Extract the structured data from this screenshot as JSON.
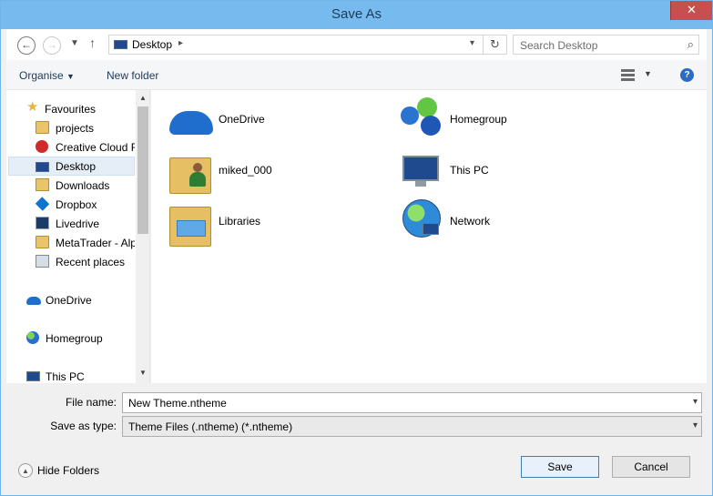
{
  "window": {
    "title": "Save As",
    "close_label": "✕"
  },
  "nav": {
    "back_icon": "arrow-left",
    "forward_icon": "arrow-right",
    "recent_icon": "chevron-down",
    "up_icon": "arrow-up",
    "address": "Desktop",
    "search_placeholder": "Search Desktop"
  },
  "toolbar": {
    "organise": "Organise",
    "new_folder": "New folder",
    "help": "?"
  },
  "sidebar": {
    "items": [
      {
        "label": "Favourites"
      },
      {
        "label": "projects"
      },
      {
        "label": "Creative Cloud Fi"
      },
      {
        "label": "Desktop",
        "selected": true
      },
      {
        "label": "Downloads"
      },
      {
        "label": "Dropbox"
      },
      {
        "label": "Livedrive"
      },
      {
        "label": "MetaTrader - Alp"
      },
      {
        "label": "Recent places"
      },
      {
        "label": "OneDrive"
      },
      {
        "label": "Homegroup"
      },
      {
        "label": "This PC"
      }
    ]
  },
  "content": {
    "items": [
      {
        "label": "OneDrive"
      },
      {
        "label": "Homegroup"
      },
      {
        "label": "miked_000"
      },
      {
        "label": "This PC"
      },
      {
        "label": "Libraries"
      },
      {
        "label": "Network"
      }
    ]
  },
  "form": {
    "file_name_label": "File name:",
    "file_name_value": "New Theme.ntheme",
    "save_as_type_label": "Save as type:",
    "save_as_type_value": "Theme Files (.ntheme) (*.ntheme)",
    "hide_folders": "Hide Folders",
    "save_button": "Save",
    "cancel_button": "Cancel"
  },
  "colors": {
    "titlebar": "#77bbee",
    "close": "#c7504f",
    "selection": "#e5eef6"
  }
}
